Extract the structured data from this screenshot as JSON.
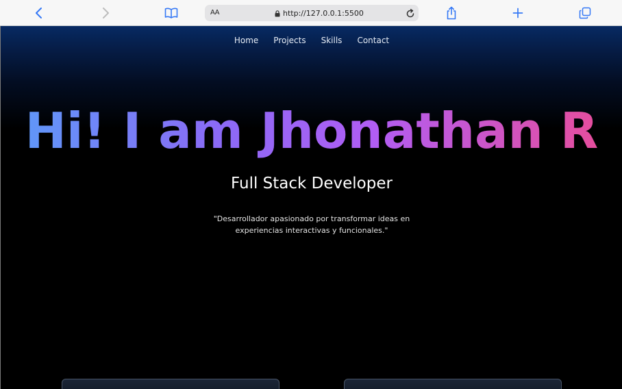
{
  "browser": {
    "text_size_label": "AA",
    "url": "http://127.0.0.1:5500",
    "icons": [
      "back-icon",
      "forward-icon",
      "bookmarks-icon",
      "lock-icon",
      "reload-icon",
      "share-icon",
      "new-tab-icon",
      "tabs-icon"
    ]
  },
  "nav": {
    "items": [
      {
        "label": "Home"
      },
      {
        "label": "Projects"
      },
      {
        "label": "Skills"
      },
      {
        "label": "Contact"
      }
    ]
  },
  "hero": {
    "title": "Hi! I am Jhonathan R",
    "subtitle": "Full Stack Developer",
    "quote_line1": "\"Desarrollador apasionado por transformar ideas en",
    "quote_line2": "experiencias interactivas y funcionales.\"",
    "gradient_colors": [
      "#5b9cf9",
      "#8b6af6",
      "#b15df3",
      "#ec4c94"
    ]
  },
  "colors": {
    "page_background": "#000000",
    "header_glow": "#072a63",
    "browser_accent": "#3478f6"
  }
}
